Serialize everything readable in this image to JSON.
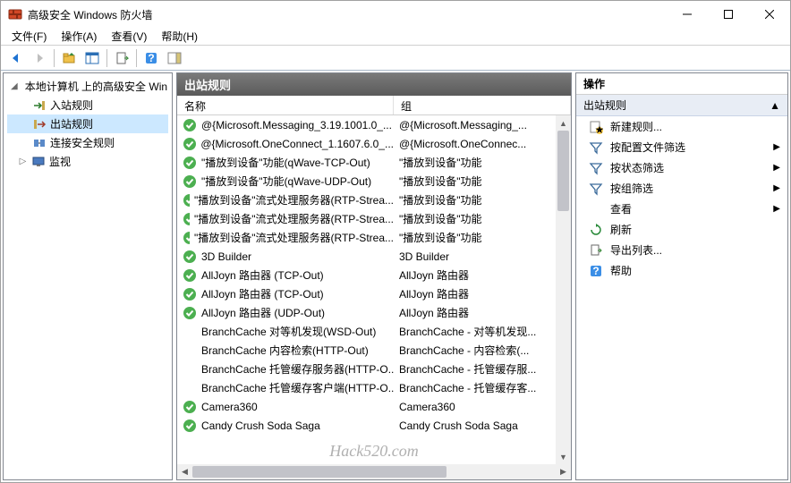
{
  "window": {
    "title": "高级安全 Windows 防火墙"
  },
  "menu": {
    "file": "文件(F)",
    "action": "操作(A)",
    "view": "查看(V)",
    "help": "帮助(H)"
  },
  "tree": {
    "root": "本地计算机 上的高级安全 Win",
    "inbound": "入站规则",
    "outbound": "出站规则",
    "connsec": "连接安全规则",
    "monitor": "监视"
  },
  "middle": {
    "title": "出站规则",
    "col_name": "名称",
    "col_group": "组"
  },
  "rules": [
    {
      "enabled": true,
      "name": "@{Microsoft.Messaging_3.19.1001.0_...",
      "group": "@{Microsoft.Messaging_..."
    },
    {
      "enabled": true,
      "name": "@{Microsoft.OneConnect_1.1607.6.0_...",
      "group": "@{Microsoft.OneConnec..."
    },
    {
      "enabled": true,
      "name": "\"播放到设备\"功能(qWave-TCP-Out)",
      "group": "\"播放到设备\"功能"
    },
    {
      "enabled": true,
      "name": "\"播放到设备\"功能(qWave-UDP-Out)",
      "group": "\"播放到设备\"功能"
    },
    {
      "enabled": true,
      "name": "\"播放到设备\"流式处理服务器(RTP-Strea...",
      "group": "\"播放到设备\"功能"
    },
    {
      "enabled": true,
      "name": "\"播放到设备\"流式处理服务器(RTP-Strea...",
      "group": "\"播放到设备\"功能"
    },
    {
      "enabled": true,
      "name": "\"播放到设备\"流式处理服务器(RTP-Strea...",
      "group": "\"播放到设备\"功能"
    },
    {
      "enabled": true,
      "name": "3D Builder",
      "group": "3D Builder"
    },
    {
      "enabled": true,
      "name": "AllJoyn 路由器 (TCP-Out)",
      "group": "AllJoyn 路由器"
    },
    {
      "enabled": true,
      "name": "AllJoyn 路由器 (TCP-Out)",
      "group": "AllJoyn 路由器"
    },
    {
      "enabled": true,
      "name": "AllJoyn 路由器 (UDP-Out)",
      "group": "AllJoyn 路由器"
    },
    {
      "enabled": false,
      "name": "BranchCache 对等机发现(WSD-Out)",
      "group": "BranchCache - 对等机发现..."
    },
    {
      "enabled": false,
      "name": "BranchCache 内容检索(HTTP-Out)",
      "group": "BranchCache - 内容检索(..."
    },
    {
      "enabled": false,
      "name": "BranchCache 托管缓存服务器(HTTP-O...",
      "group": "BranchCache - 托管缓存服..."
    },
    {
      "enabled": false,
      "name": "BranchCache 托管缓存客户端(HTTP-O...",
      "group": "BranchCache - 托管缓存客..."
    },
    {
      "enabled": true,
      "name": "Camera360",
      "group": "Camera360"
    },
    {
      "enabled": true,
      "name": "Candy Crush Soda Saga",
      "group": "Candy Crush Soda Saga"
    }
  ],
  "right": {
    "title": "操作",
    "section": "出站规则",
    "new_rule": "新建规则...",
    "filter_profile": "按配置文件筛选",
    "filter_state": "按状态筛选",
    "filter_group": "按组筛选",
    "view": "查看",
    "refresh": "刷新",
    "export": "导出列表...",
    "help": "帮助"
  },
  "watermark": "Hack520.com"
}
